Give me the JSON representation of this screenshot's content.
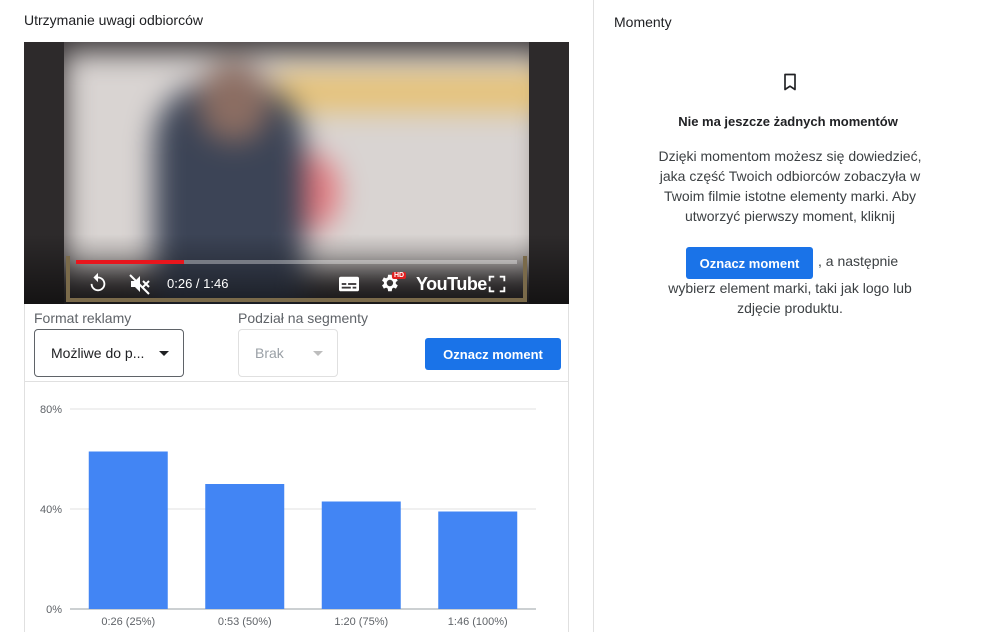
{
  "left_panel": {
    "title": "Utrzymanie uwagi odbiorców"
  },
  "video": {
    "time_display": "0:26 / 1:46",
    "progress_fraction": 0.245,
    "brand": "YouTube",
    "hd_badge": "HD",
    "icons": [
      "replay-icon",
      "mute-icon",
      "subtitles-icon",
      "settings-icon",
      "fullscreen-icon"
    ]
  },
  "controls": {
    "format_label": "Format reklamy",
    "format_value": "Możliwe do p...",
    "segment_label": "Podział na segmenty",
    "segment_value": "Brak",
    "mark_button": "Oznacz moment"
  },
  "chart_data": {
    "type": "bar",
    "categories": [
      "0:26 (25%)",
      "0:53 (50%)",
      "1:20 (75%)",
      "1:46 (100%)"
    ],
    "values": [
      63,
      50,
      43,
      39
    ],
    "ylim": [
      0,
      80
    ],
    "yticks": [
      "0%",
      "40%",
      "80%"
    ],
    "ytick_values": [
      0,
      40,
      80
    ],
    "grid": true,
    "color": "#4285f4"
  },
  "right_panel": {
    "title": "Momenty",
    "empty_title": "Nie ma jeszcze żadnych momentów",
    "empty_text_before": "Dzięki momentom możesz się dowiedzieć, jaka część Twoich odbiorców zobaczyła w Twoim filmie istotne elementy marki. Aby utworzyć pierwszy moment, kliknij",
    "inline_button": "Oznacz moment",
    "empty_text_after_inline": ", a następnie",
    "empty_text_after": "wybierz element marki, taki jak logo lub zdjęcie produktu."
  },
  "colors": {
    "accent": "#1a73e8",
    "bar": "#4285f4",
    "progress": "#e8161d"
  }
}
